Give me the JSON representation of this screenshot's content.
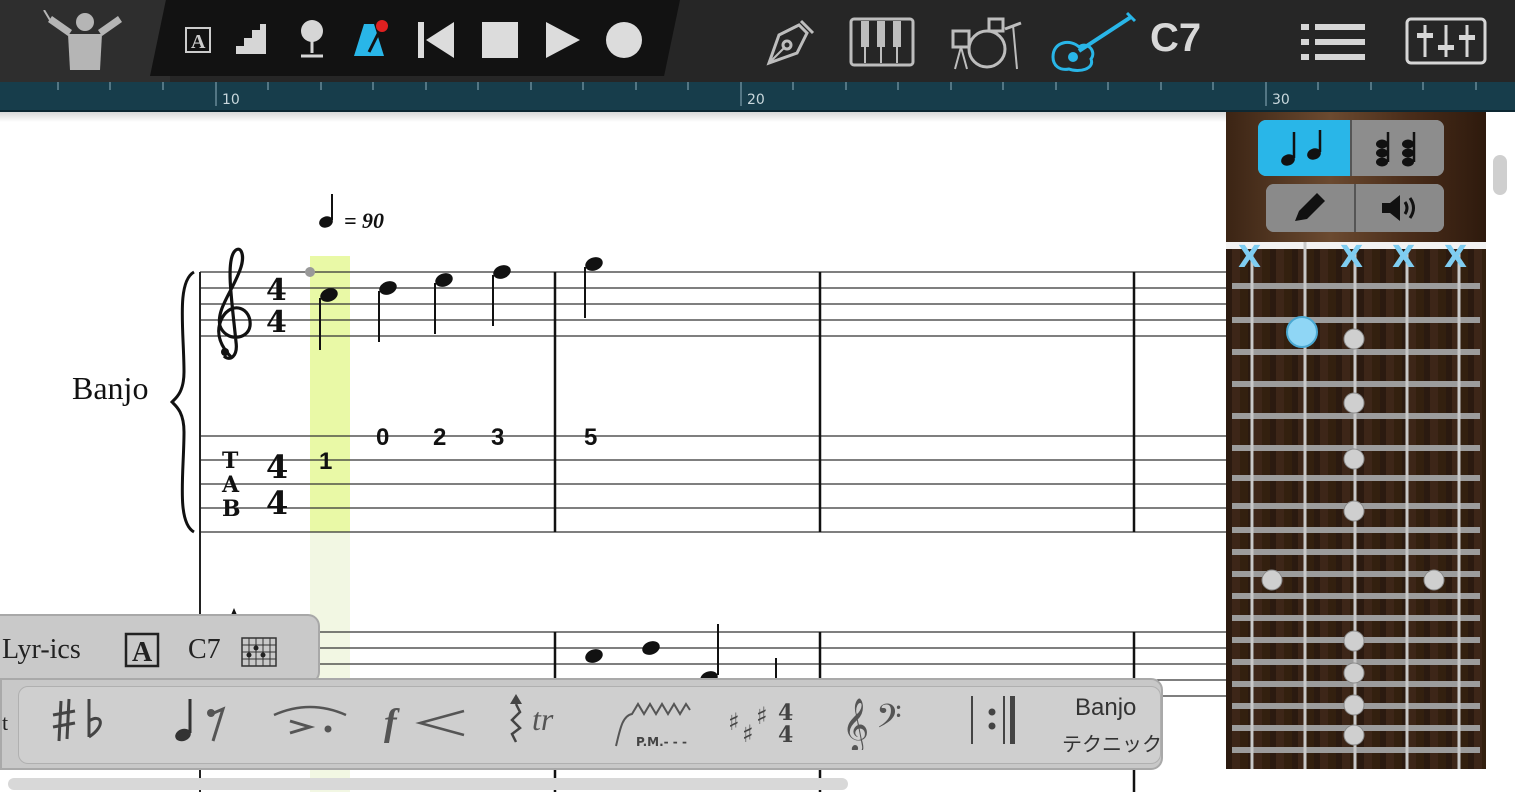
{
  "toolbar": {
    "chord_symbol": "C7",
    "buttons": {
      "conductor": "conductor-icon",
      "text_style": "text-box-icon",
      "staircase": "step-input-icon",
      "pin": "pin-icon",
      "metronome": "metronome-icon",
      "rewind": "skip-to-start-icon",
      "stop": "stop-icon",
      "play": "play-icon",
      "record": "record-icon",
      "pen": "pen-nib-icon",
      "piano": "piano-keyboard-icon",
      "drums": "drum-kit-icon",
      "guitar": "guitar-icon",
      "menu": "list-menu-icon",
      "mixer": "mixer-icon"
    },
    "active_color": "#29b6e8"
  },
  "ruler": {
    "marks": [
      "10",
      "20",
      "30"
    ]
  },
  "score": {
    "instrument": "Banjo",
    "tempo_value": "= 90",
    "time_signature": "4/4",
    "tab_clef": [
      "T",
      "A",
      "B"
    ],
    "tab_numbers": [
      "1",
      "0",
      "2",
      "3",
      "5"
    ],
    "highlight_color": "#e9f9a6"
  },
  "fretboard": {
    "input_mode_tabs": [
      "single-note-icon",
      "chord-notes-icon"
    ],
    "mode_tabs": [
      "pencil-icon",
      "speaker-icon"
    ],
    "muted_marker": "X",
    "muted_strings": 4
  },
  "palettes": {
    "lyrics": "Lyr-ics",
    "chord": "C7",
    "left_clip": "t",
    "banjo_technique_name": "Banjo",
    "banjo_technique_label": "テクニック",
    "tools": [
      "accidentals-icon",
      "note-rest-icon",
      "articulation-icon",
      "dynamics-icon",
      "trill-icon",
      "palm-mute-icon",
      "key-signature-icon",
      "clef-icon",
      "repeat-barline-icon"
    ]
  }
}
